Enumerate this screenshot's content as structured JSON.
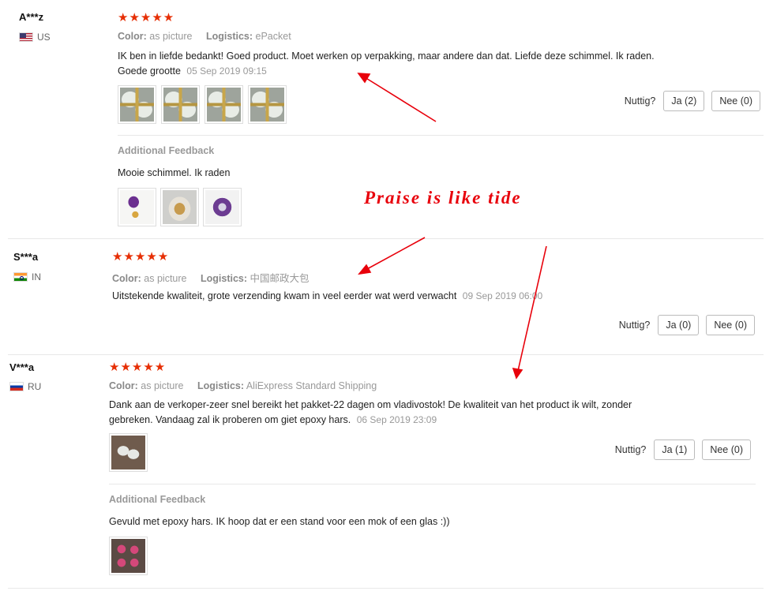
{
  "reviews": [
    {
      "name": "A***z",
      "country": "US",
      "flag": "us-flag-icon",
      "stars": "★★★★★",
      "color_label": "Color:",
      "color_value": "as picture",
      "logistics_label": "Logistics:",
      "logistics_value": "ePacket",
      "text": "IK ben in liefde bedankt! Goed product. Moet werken op verpakking, maar andere dan dat. Liefde deze schimmel. Ik raden. Goede grootte",
      "date": "05 Sep 2019 09:15",
      "photos": [
        "mold-photo",
        "mold-photo",
        "mold-photo",
        "mold-photo"
      ],
      "helpful_label": "Nuttig?",
      "yes_label": "Ja (2)",
      "no_label": "Nee (0)",
      "additional_title": "Additional Feedback",
      "additional_text": "Mooie schimmel. Ik raden",
      "additional_photos": [
        "purple-geode-photo",
        "gold-resin-photo",
        "purple-resin-photo"
      ]
    },
    {
      "name": "S***a",
      "country": "IN",
      "flag": "india-flag-icon",
      "stars": "★★★★★",
      "color_label": "Color:",
      "color_value": "as picture",
      "logistics_label": "Logistics:",
      "logistics_value": "中国邮政大包",
      "text": "Uitstekende kwaliteit, grote verzending kwam in veel eerder wat werd verwacht",
      "date": "09 Sep 2019 06:00",
      "helpful_label": "Nuttig?",
      "yes_label": "Ja (0)",
      "no_label": "Nee (0)"
    },
    {
      "name": "V***a",
      "country": "RU",
      "flag": "russia-flag-icon",
      "stars": "★★★★★",
      "color_label": "Color:",
      "color_value": "as picture",
      "logistics_label": "Logistics:",
      "logistics_value": "AliExpress Standard Shipping",
      "text": "Dank aan de verkoper-zeer snel bereikt het pakket-22 dagen om vladivostok! De kwaliteit van het product ik wilt, zonder gebreken. Vandaag zal ik proberen om giet epoxy hars.",
      "date": "06 Sep 2019 23:09",
      "photos": [
        "clear-mold-photo"
      ],
      "helpful_label": "Nuttig?",
      "yes_label": "Ja (1)",
      "no_label": "Nee (0)",
      "additional_title": "Additional Feedback",
      "additional_text": "Gevuld met epoxy hars. IK hoop dat er een stand voor een mok of een glas :))",
      "additional_photos": [
        "pink-resin-photo"
      ]
    }
  ],
  "annotation": {
    "text": "Praise is like tide",
    "color": "#e8000b"
  },
  "colors": {
    "star": "#e62e04",
    "muted": "#999999",
    "text": "#222222"
  }
}
